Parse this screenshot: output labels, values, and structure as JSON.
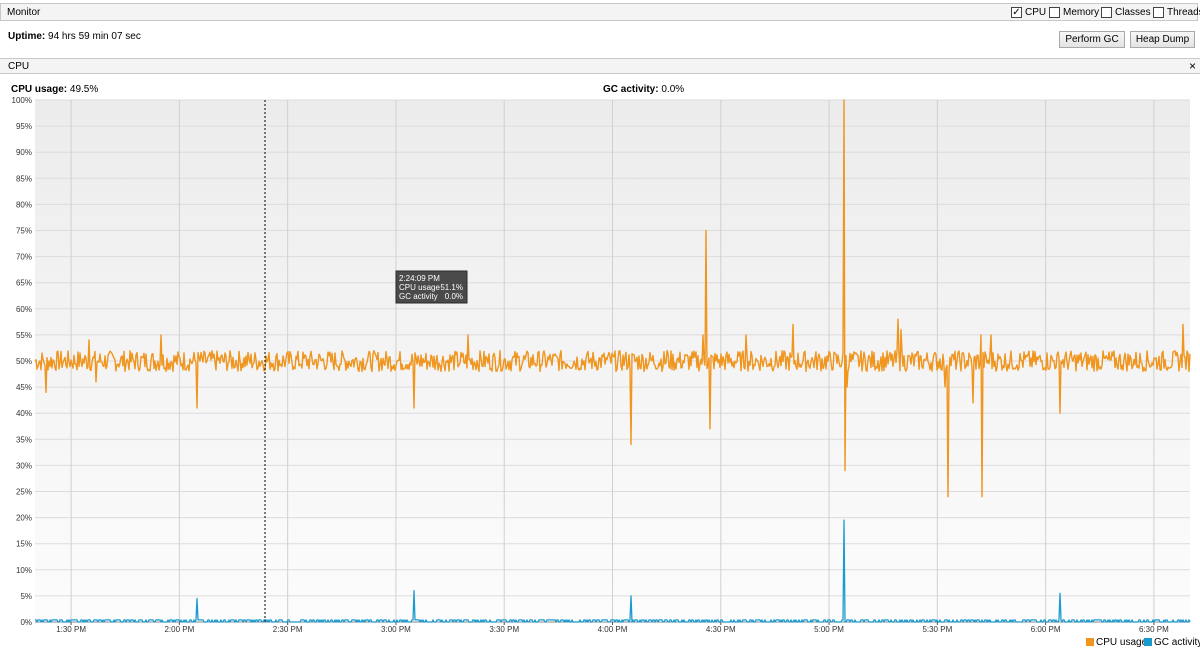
{
  "monitor": {
    "title": "Monitor",
    "checkboxes": [
      {
        "label": "CPU",
        "checked": true
      },
      {
        "label": "Memory",
        "checked": false
      },
      {
        "label": "Classes",
        "checked": false
      },
      {
        "label": "Threads",
        "checked": false
      }
    ],
    "uptime_label": "Uptime:",
    "uptime_value": "94 hrs 59 min 07 sec",
    "perform_gc": "Perform GC",
    "heap_dump": "Heap Dump"
  },
  "cpu_panel": {
    "title": "CPU",
    "close_glyph": "×",
    "cpu_usage_label": "CPU usage:",
    "cpu_usage_value": "49.5%",
    "gc_activity_label": "GC activity:",
    "gc_activity_value": "0.0%",
    "tooltip": {
      "time": "2:24:09 PM",
      "cpu_label": "CPU usage",
      "cpu_value": "51.1%",
      "gc_label": "GC activity",
      "gc_value": "0.0%"
    },
    "legend": [
      {
        "name": "CPU usage",
        "color": "#f0951e"
      },
      {
        "name": "GC activity",
        "color": "#1a9bd0"
      }
    ]
  },
  "chart_data": {
    "type": "line",
    "title": "",
    "xlabel": "",
    "ylabel": "",
    "ylim": [
      0,
      100
    ],
    "y_ticks": [
      0,
      5,
      10,
      15,
      20,
      25,
      30,
      35,
      40,
      45,
      50,
      55,
      60,
      65,
      70,
      75,
      80,
      85,
      90,
      95,
      100
    ],
    "y_tick_suffix": "%",
    "x_ticks": [
      "1:30 PM",
      "2:00 PM",
      "2:30 PM",
      "3:00 PM",
      "3:30 PM",
      "4:00 PM",
      "4:30 PM",
      "5:00 PM",
      "5:30 PM",
      "6:00 PM",
      "6:30 PM"
    ],
    "x_range": [
      "1:20 PM",
      "6:40 PM"
    ],
    "grid": true,
    "legend_position": "bottom-right",
    "cursor_time": "2:24:09 PM",
    "series": [
      {
        "name": "CPU usage",
        "color": "#f0951e",
        "baseline": 50,
        "noise_amplitude": 2,
        "spikes": [
          {
            "time": "1:23 PM",
            "value": 44
          },
          {
            "time": "1:35 PM",
            "value": 54
          },
          {
            "time": "1:37 PM",
            "value": 46
          },
          {
            "time": "1:55 PM",
            "value": 55
          },
          {
            "time": "2:05 PM",
            "value": 41
          },
          {
            "time": "3:05 PM",
            "value": 41
          },
          {
            "time": "3:20 PM",
            "value": 55
          },
          {
            "time": "4:05 PM",
            "value": 34
          },
          {
            "time": "4:15 PM",
            "value": 52
          },
          {
            "time": "4:25 PM",
            "value": 55
          },
          {
            "time": "4:26 PM",
            "value": 75
          },
          {
            "time": "4:27 PM",
            "value": 37
          },
          {
            "time": "4:37 PM",
            "value": 55
          },
          {
            "time": "4:50 PM",
            "value": 57
          },
          {
            "time": "5:04 PM",
            "value": 100
          },
          {
            "time": "5:04:30 PM",
            "value": 29
          },
          {
            "time": "5:05 PM",
            "value": 45
          },
          {
            "time": "5:19 PM",
            "value": 58
          },
          {
            "time": "5:20 PM",
            "value": 56
          },
          {
            "time": "5:32 PM",
            "value": 45
          },
          {
            "time": "5:33 PM",
            "value": 24
          },
          {
            "time": "5:40 PM",
            "value": 42
          },
          {
            "time": "5:42 PM",
            "value": 55
          },
          {
            "time": "5:42:30 PM",
            "value": 24
          },
          {
            "time": "5:45 PM",
            "value": 55
          },
          {
            "time": "6:04 PM",
            "value": 40
          },
          {
            "time": "6:38 PM",
            "value": 57
          }
        ]
      },
      {
        "name": "GC activity",
        "color": "#1a9bd0",
        "baseline": 0,
        "spikes": [
          {
            "time": "2:05 PM",
            "value": 4.5
          },
          {
            "time": "3:05 PM",
            "value": 6
          },
          {
            "time": "4:05 PM",
            "value": 5
          },
          {
            "time": "5:04 PM",
            "value": 19.5
          },
          {
            "time": "6:04 PM",
            "value": 5.5
          }
        ]
      }
    ]
  }
}
